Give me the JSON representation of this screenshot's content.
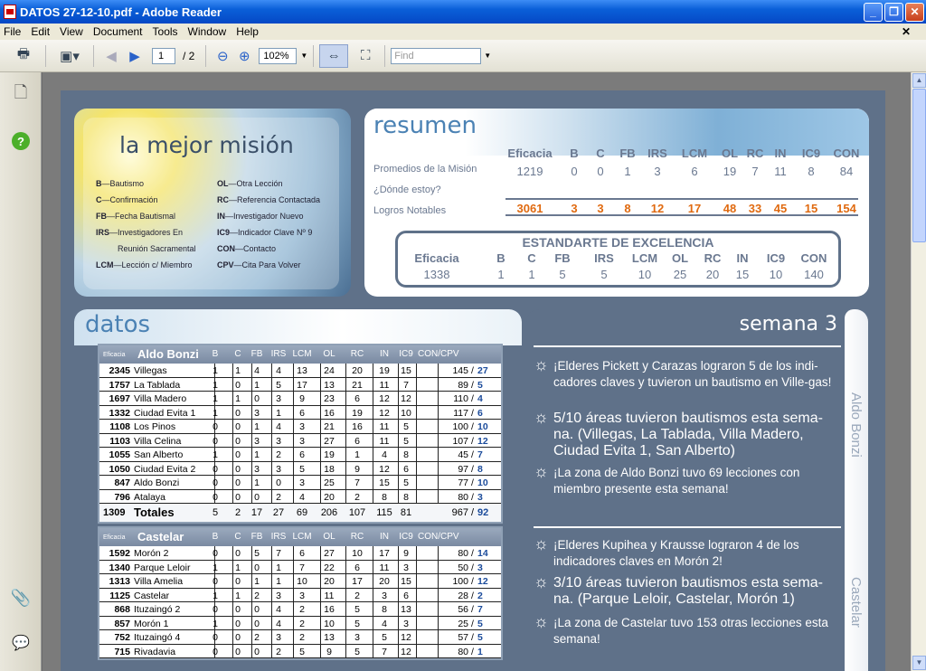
{
  "window": {
    "title": "DATOS 27-12-10.pdf - Adobe Reader"
  },
  "menu": [
    "File",
    "Edit",
    "View",
    "Document",
    "Tools",
    "Window",
    "Help"
  ],
  "toolbar": {
    "page_current": "1",
    "page_total": "/ 2",
    "zoom": "102%",
    "find_placeholder": "Find"
  },
  "mision": {
    "title": "la mejor misión",
    "legend_left": [
      [
        "B",
        "—Bautismo"
      ],
      [
        "C",
        "—Confirmación"
      ],
      [
        "FB",
        "—Fecha Bautismal"
      ],
      [
        "IRS",
        "—Investigadores En"
      ],
      [
        "",
        "Reunión Sacramental"
      ],
      [
        "LCM",
        "—Lección c/ Miembro"
      ]
    ],
    "legend_right": [
      [
        "OL",
        "—Otra Lección"
      ],
      [
        "RC",
        "—Referencia Contactada"
      ],
      [
        "IN",
        "—Investigador Nuevo"
      ],
      [
        "IC9",
        "—Indicador Clave Nº 9"
      ],
      [
        "CON",
        "—Contacto"
      ],
      [
        "CPV",
        "—Cita Para Volver"
      ]
    ]
  },
  "resumen": {
    "title": "resumen",
    "headers": [
      "Eficacia",
      "B",
      "C",
      "FB",
      "IRS",
      "LCM",
      "OL",
      "RC",
      "IN",
      "IC9",
      "CON"
    ],
    "row_labels": [
      "Promedios de la Misión",
      "¿Dónde estoy?",
      "Logros Notables"
    ],
    "promedios": [
      "1219",
      "0",
      "0",
      "1",
      "3",
      "6",
      "19",
      "7",
      "11",
      "8",
      "84"
    ],
    "logros": [
      "3061",
      "3",
      "3",
      "8",
      "12",
      "17",
      "48",
      "33",
      "45",
      "15",
      "154"
    ],
    "estandarte_title": "ESTANDARTE DE EXCELENCIA",
    "estandarte_headers": [
      "Eficacia",
      "B",
      "C",
      "FB",
      "IRS",
      "LCM",
      "OL",
      "RC",
      "IN",
      "IC9",
      "CON"
    ],
    "estandarte_values": [
      "1338",
      "1",
      "1",
      "5",
      "5",
      "10",
      "25",
      "20",
      "15",
      "10",
      "140"
    ]
  },
  "datos": {
    "title": "datos",
    "col_headers": [
      "B",
      "C",
      "FB",
      "IRS",
      "LCM",
      "OL",
      "RC",
      "IN",
      "IC9",
      "CON/CPV"
    ],
    "eficacia_label": "Eficacia",
    "zonas": [
      {
        "name": "Aldo Bonzi",
        "rows": [
          [
            "2345",
            "Villegas",
            "1",
            "1",
            "4",
            "4",
            "13",
            "24",
            "20",
            "19",
            "15",
            "145",
            "27"
          ],
          [
            "1757",
            "La Tablada",
            "1",
            "0",
            "1",
            "5",
            "17",
            "13",
            "21",
            "11",
            "7",
            "89",
            "5"
          ],
          [
            "1697",
            "Villa Madero",
            "1",
            "1",
            "0",
            "3",
            "9",
            "23",
            "6",
            "12",
            "12",
            "110",
            "4"
          ],
          [
            "1332",
            "Ciudad Evita 1",
            "1",
            "0",
            "3",
            "1",
            "6",
            "16",
            "19",
            "12",
            "10",
            "117",
            "6"
          ],
          [
            "1108",
            "Los Pinos",
            "0",
            "0",
            "1",
            "4",
            "3",
            "21",
            "16",
            "11",
            "5",
            "100",
            "10"
          ],
          [
            "1103",
            "Villa Celina",
            "0",
            "0",
            "3",
            "3",
            "3",
            "27",
            "6",
            "11",
            "5",
            "107",
            "12"
          ],
          [
            "1055",
            "San Alberto",
            "1",
            "0",
            "1",
            "2",
            "6",
            "19",
            "1",
            "4",
            "8",
            "45",
            "7"
          ],
          [
            "1050",
            "Ciudad Evita 2",
            "0",
            "0",
            "3",
            "3",
            "5",
            "18",
            "9",
            "12",
            "6",
            "97",
            "8"
          ],
          [
            "847",
            "Aldo Bonzi",
            "0",
            "0",
            "1",
            "0",
            "3",
            "25",
            "7",
            "15",
            "5",
            "77",
            "10"
          ],
          [
            "796",
            "Atalaya",
            "0",
            "0",
            "0",
            "2",
            "4",
            "20",
            "2",
            "8",
            "8",
            "80",
            "3"
          ]
        ],
        "totales": {
          "label": "Totales",
          "eficacia": "1309",
          "vals": [
            "5",
            "2",
            "17",
            "27",
            "69",
            "206",
            "107",
            "115",
            "81",
            "967",
            "92"
          ]
        }
      },
      {
        "name": "Castelar",
        "rows": [
          [
            "1592",
            "Morón 2",
            "0",
            "0",
            "5",
            "7",
            "6",
            "27",
            "10",
            "17",
            "9",
            "80",
            "14"
          ],
          [
            "1340",
            "Parque Leloir",
            "1",
            "1",
            "0",
            "1",
            "7",
            "22",
            "6",
            "11",
            "3",
            "50",
            "3"
          ],
          [
            "1313",
            "Villa Amelia",
            "0",
            "0",
            "1",
            "1",
            "10",
            "20",
            "17",
            "20",
            "15",
            "100",
            "12"
          ],
          [
            "1125",
            "Castelar",
            "1",
            "1",
            "2",
            "3",
            "3",
            "11",
            "2",
            "3",
            "6",
            "28",
            "2"
          ],
          [
            "868",
            "Ituzaingó 2",
            "0",
            "0",
            "0",
            "4",
            "2",
            "16",
            "5",
            "8",
            "13",
            "56",
            "7"
          ],
          [
            "857",
            "Morón 1",
            "1",
            "0",
            "0",
            "4",
            "2",
            "10",
            "5",
            "4",
            "3",
            "25",
            "5"
          ],
          [
            "752",
            "Ituzaingó 4",
            "0",
            "0",
            "2",
            "3",
            "2",
            "13",
            "3",
            "5",
            "12",
            "57",
            "5"
          ],
          [
            "715",
            "Rivadavia",
            "0",
            "0",
            "0",
            "2",
            "5",
            "9",
            "5",
            "7",
            "12",
            "80",
            "1"
          ]
        ]
      }
    ]
  },
  "semana": {
    "title": "semana 3",
    "zona1": "Aldo Bonzi",
    "zona2": "Castelar",
    "bullets1": [
      "¡Elderes Pickett y Carazas lograron 5 de los indi-cadores claves y tuvieron un bautismo en Ville-gas!",
      "5/10 áreas tuvieron bautismos esta sema-na. (Villegas, La Tablada, Villa Madero, Ciudad Evita 1, San Alberto)",
      "¡La zona de Aldo Bonzi tuvo 69 lecciones con miembro presente esta semana!"
    ],
    "bullets2": [
      "¡Elderes Kupihea y Krausse lograron 4 de los indicadores claves en Morón 2!",
      "3/10 áreas tuvieron bautismos esta sema-na. (Parque Leloir, Castelar, Morón 1)",
      "¡La zona de Castelar tuvo 153 otras lecciones esta semana!"
    ]
  }
}
